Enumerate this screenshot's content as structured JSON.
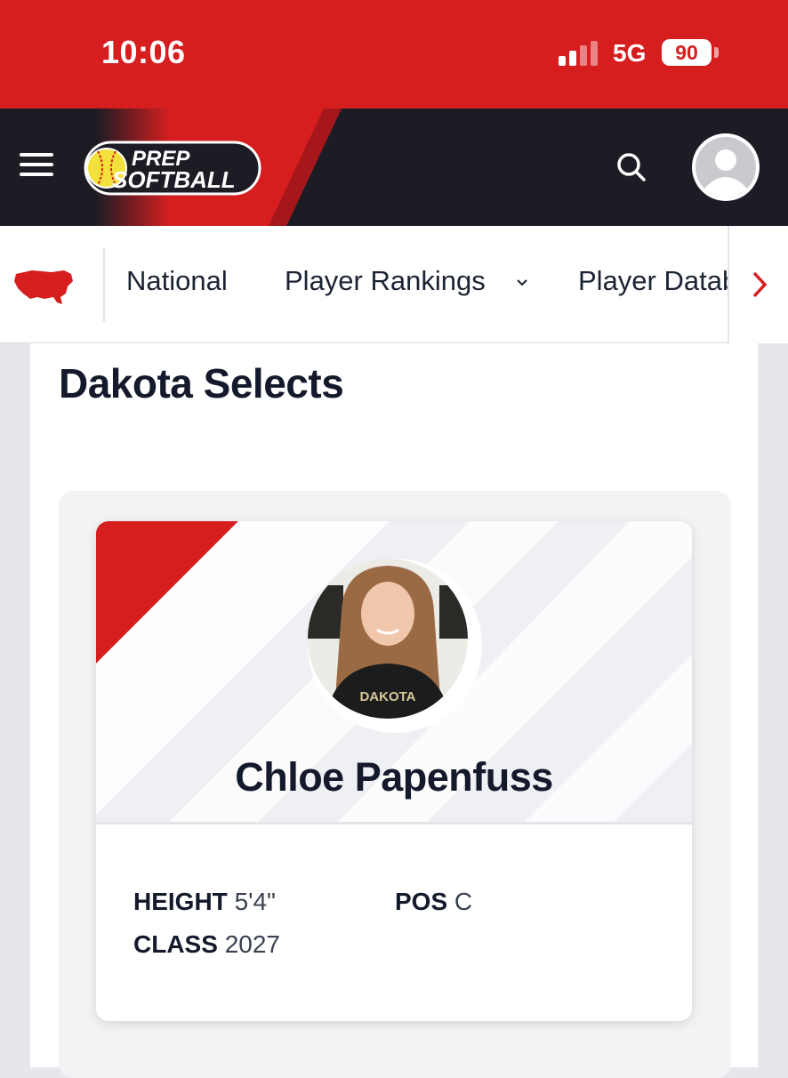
{
  "status_bar": {
    "time": "10:06",
    "network": "5G",
    "battery": "90"
  },
  "header": {
    "logo_line1": "PREP",
    "logo_line2": "SOFTBALL",
    "menu_icon": "hamburger-menu-icon",
    "search_icon": "search-icon",
    "avatar_icon": "user-avatar-icon",
    "brand_color": "#d71e1f",
    "dark_color": "#1b1c24"
  },
  "subnav": {
    "region_icon": "us-map-icon",
    "items": [
      {
        "label": "National"
      },
      {
        "label": "Player Rankings"
      },
      {
        "label": "Player Database"
      }
    ],
    "scroll_icon": "chevron-right-icon"
  },
  "page": {
    "team_title": "Dakota Selects"
  },
  "player": {
    "name": "Chloe Papenfuss",
    "height_label": "HEIGHT",
    "height_value": "5'4\"",
    "pos_label": "POS",
    "pos_value": "C",
    "class_label": "CLASS",
    "class_value": "2027",
    "photo_shirt_text": "DAKOTA"
  }
}
